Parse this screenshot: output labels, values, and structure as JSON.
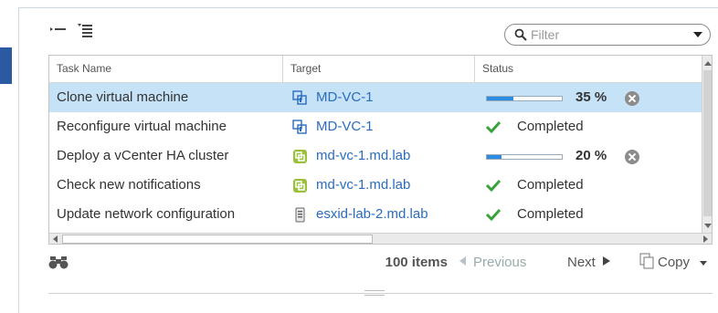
{
  "toolbar": {
    "collapse_icon": "collapse-all-icon",
    "list_icon": "list-settings-icon"
  },
  "filter": {
    "placeholder": "Filter",
    "icon": "search-icon"
  },
  "table": {
    "columns": [
      "Task Name",
      "Target",
      "Status"
    ],
    "rows": [
      {
        "task": "Clone virtual machine",
        "target": "MD-VC-1",
        "target_icon": "vcenter-icon",
        "status_type": "progress",
        "progress": 35,
        "progress_text": "35 %",
        "selected": true
      },
      {
        "task": "Reconfigure virtual machine",
        "target": "MD-VC-1",
        "target_icon": "vcenter-icon",
        "status_type": "completed",
        "status_text": "Completed",
        "selected": false
      },
      {
        "task": "Deploy a vCenter HA cluster",
        "target": "md-vc-1.md.lab",
        "target_icon": "vm-icon",
        "status_type": "progress",
        "progress": 20,
        "progress_text": "20 %",
        "selected": false
      },
      {
        "task": "Check new notifications",
        "target": "md-vc-1.md.lab",
        "target_icon": "vm-icon",
        "status_type": "completed",
        "status_text": "Completed",
        "selected": false
      },
      {
        "task": "Update network configuration",
        "target": "esxid-lab-2.md.lab",
        "target_icon": "host-icon",
        "status_type": "completed",
        "status_text": "Completed",
        "selected": false
      }
    ]
  },
  "footer": {
    "items_count": "100 items",
    "previous_label": "Previous",
    "next_label": "Next",
    "copy_label": "Copy"
  },
  "colors": {
    "selected_row": "#c6e2f7",
    "link": "#2a6cbf",
    "progress_fill": "#2b8de2",
    "check_green": "#3aa23a"
  }
}
